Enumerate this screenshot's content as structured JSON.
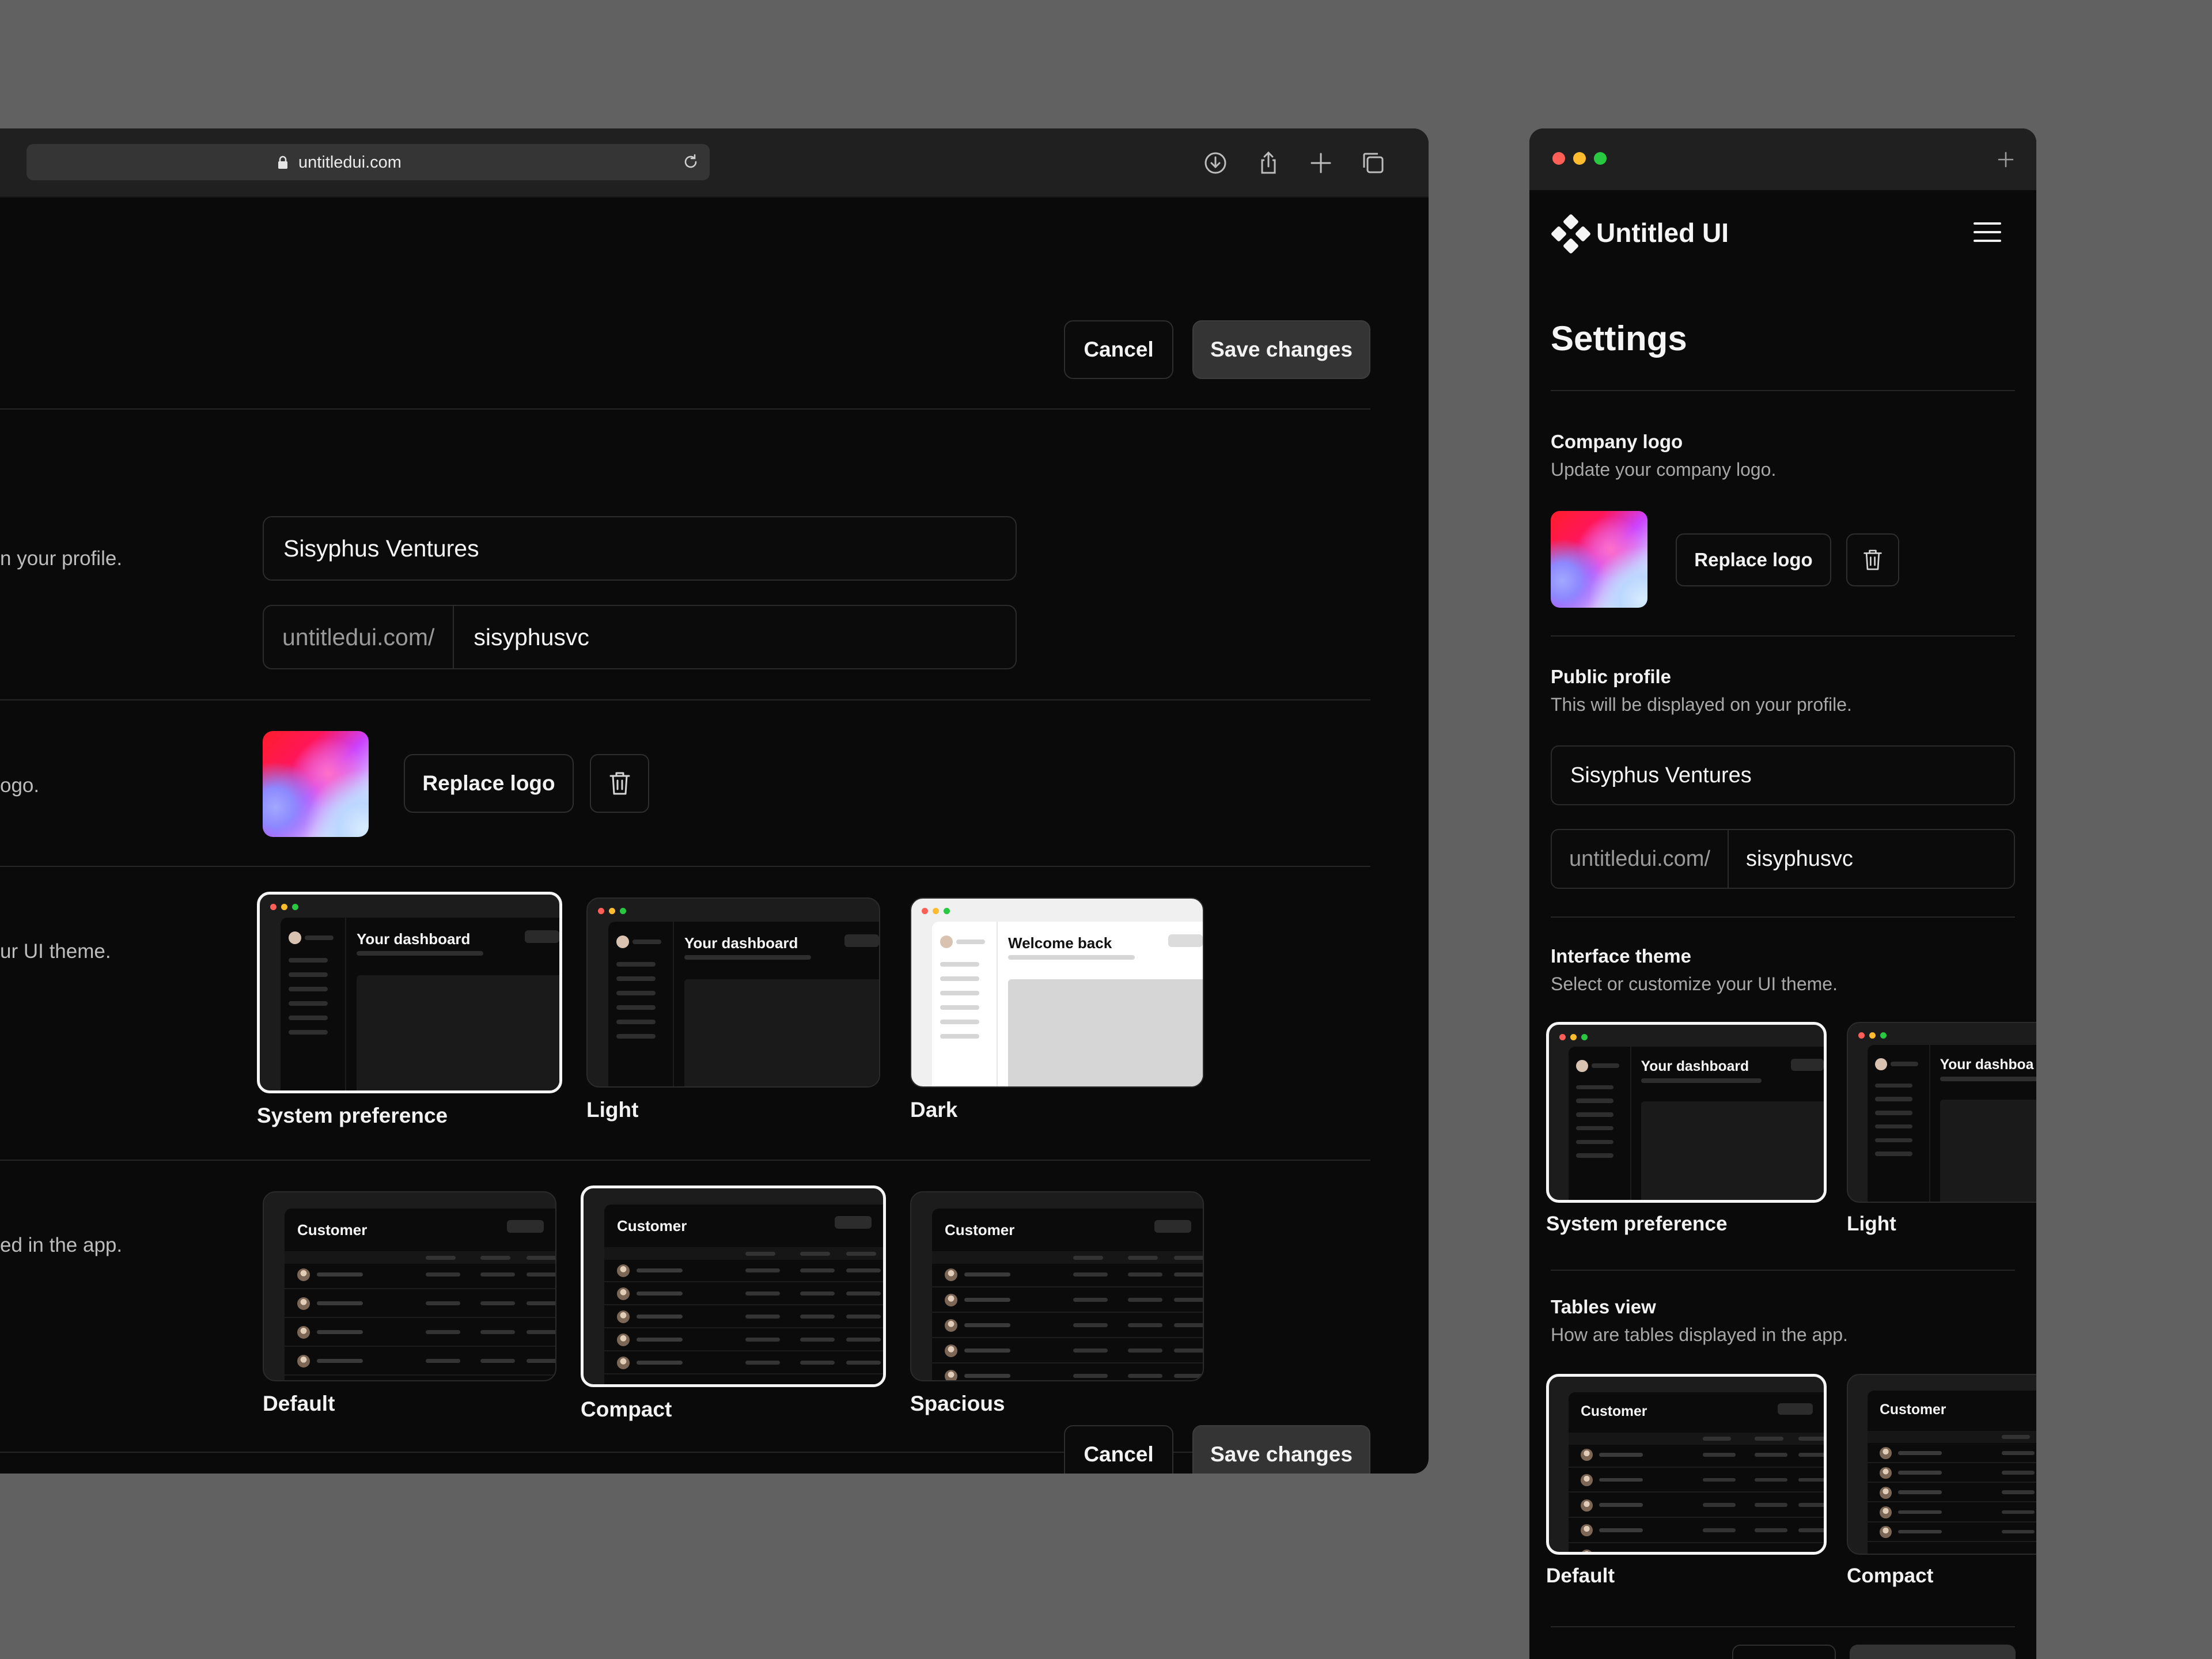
{
  "desktop": {
    "url": "untitledui.com",
    "cancel_label": "Cancel",
    "save_label": "Save changes",
    "profile_desc_fragment": "n your profile.",
    "company_name": "Sisyphus Ventures",
    "url_prefix": "untitledui.com/",
    "url_slug": "sisyphusvc",
    "logo_desc_fragment": "ogo.",
    "replace_logo_label": "Replace logo",
    "theme_desc_fragment": "ur UI theme.",
    "tables_desc_fragment": "ed in the app.",
    "themes": [
      {
        "label": "System preference",
        "mini": "Your dashboard",
        "selected": true
      },
      {
        "label": "Light",
        "mini": "Your dashboard",
        "selected": false
      },
      {
        "label": "Dark",
        "mini": "Welcome back",
        "selected": false
      }
    ],
    "tables": [
      {
        "label": "Default",
        "mini": "Customer",
        "selected": false
      },
      {
        "label": "Compact",
        "mini": "Customer",
        "selected": true
      },
      {
        "label": "Spacious",
        "mini": "Customer",
        "selected": false
      }
    ]
  },
  "mobile": {
    "brand": "Untitled UI",
    "title": "Settings",
    "company_logo_label": "Company logo",
    "company_logo_desc": "Update your company logo.",
    "replace_logo_label": "Replace logo",
    "public_profile_label": "Public profile",
    "public_profile_desc": "This will be displayed on your profile.",
    "company_name": "Sisyphus Ventures",
    "url_prefix": "untitledui.com/",
    "url_slug": "sisyphusvc",
    "interface_theme_label": "Interface theme",
    "interface_theme_desc": "Select or customize your UI theme.",
    "themes": [
      {
        "label": "System preference",
        "mini": "Your dashboard",
        "selected": true
      },
      {
        "label": "Light",
        "mini": "Your dashboa",
        "selected": false
      }
    ],
    "tables_view_label": "Tables view",
    "tables_view_desc": "How are tables displayed in the app.",
    "tables": [
      {
        "label": "Default",
        "mini": "Customer",
        "selected": true
      },
      {
        "label": "Compact",
        "mini": "Customer",
        "selected": false
      }
    ]
  },
  "colors": {
    "background": "#616161",
    "window": "#0a0a0a",
    "toolbar": "#202020",
    "traffic_red": "#ff5f57",
    "traffic_yellow": "#febc2e",
    "traffic_green": "#28c840"
  },
  "icons": [
    "lock-icon",
    "reload-icon",
    "download-icon",
    "share-icon",
    "plus-icon",
    "tabs-icon",
    "trash-icon",
    "menu-icon",
    "logo-mark-icon"
  ]
}
